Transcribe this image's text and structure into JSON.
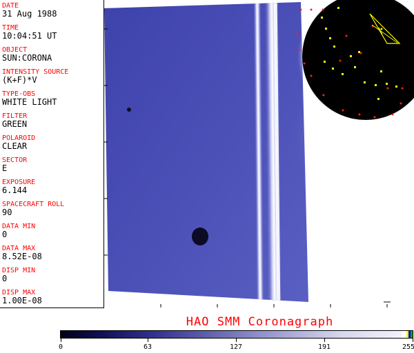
{
  "metadata": [
    {
      "label": "DATE",
      "value": "31 Aug 1988"
    },
    {
      "label": "TIME",
      "value": "10:04:51 UT"
    },
    {
      "label": "OBJECT",
      "value": "SUN:CORONA"
    },
    {
      "label": "INTENSITY SOURCE",
      "value": "(K+F)*V"
    },
    {
      "label": "TYPE-OBS",
      "value": "WHITE LIGHT"
    },
    {
      "label": "FILTER",
      "value": "GREEN"
    },
    {
      "label": "POLAROID",
      "value": "CLEAR"
    },
    {
      "label": "SECTOR",
      "value": "E"
    },
    {
      "label": "EXPOSURE",
      "value": "6.144"
    },
    {
      "label": "SPACECRAFT ROLL",
      "value": "90"
    },
    {
      "label": "DATA MIN",
      "value": "0"
    },
    {
      "label": "DATA MAX",
      "value": "8.52E-08"
    },
    {
      "label": "DISP MIN",
      "value": "0"
    },
    {
      "label": "DISP MAX",
      "value": "1.00E-08"
    }
  ],
  "title": "HAO  SMM Coronagraph",
  "colorbar": {
    "ticks": [
      "0",
      "63",
      "127",
      "191",
      "255"
    ],
    "min": 0,
    "max": 255,
    "cap_colors": [
      "#ffff00",
      "#0000ff",
      "#00aa00"
    ]
  },
  "colors": {
    "label": "#ff0000",
    "value": "#000000",
    "image_background": "#4b4fb6",
    "occulter": "#000000",
    "marker_red": "#ff2020",
    "marker_yellow": "#ffff00"
  }
}
